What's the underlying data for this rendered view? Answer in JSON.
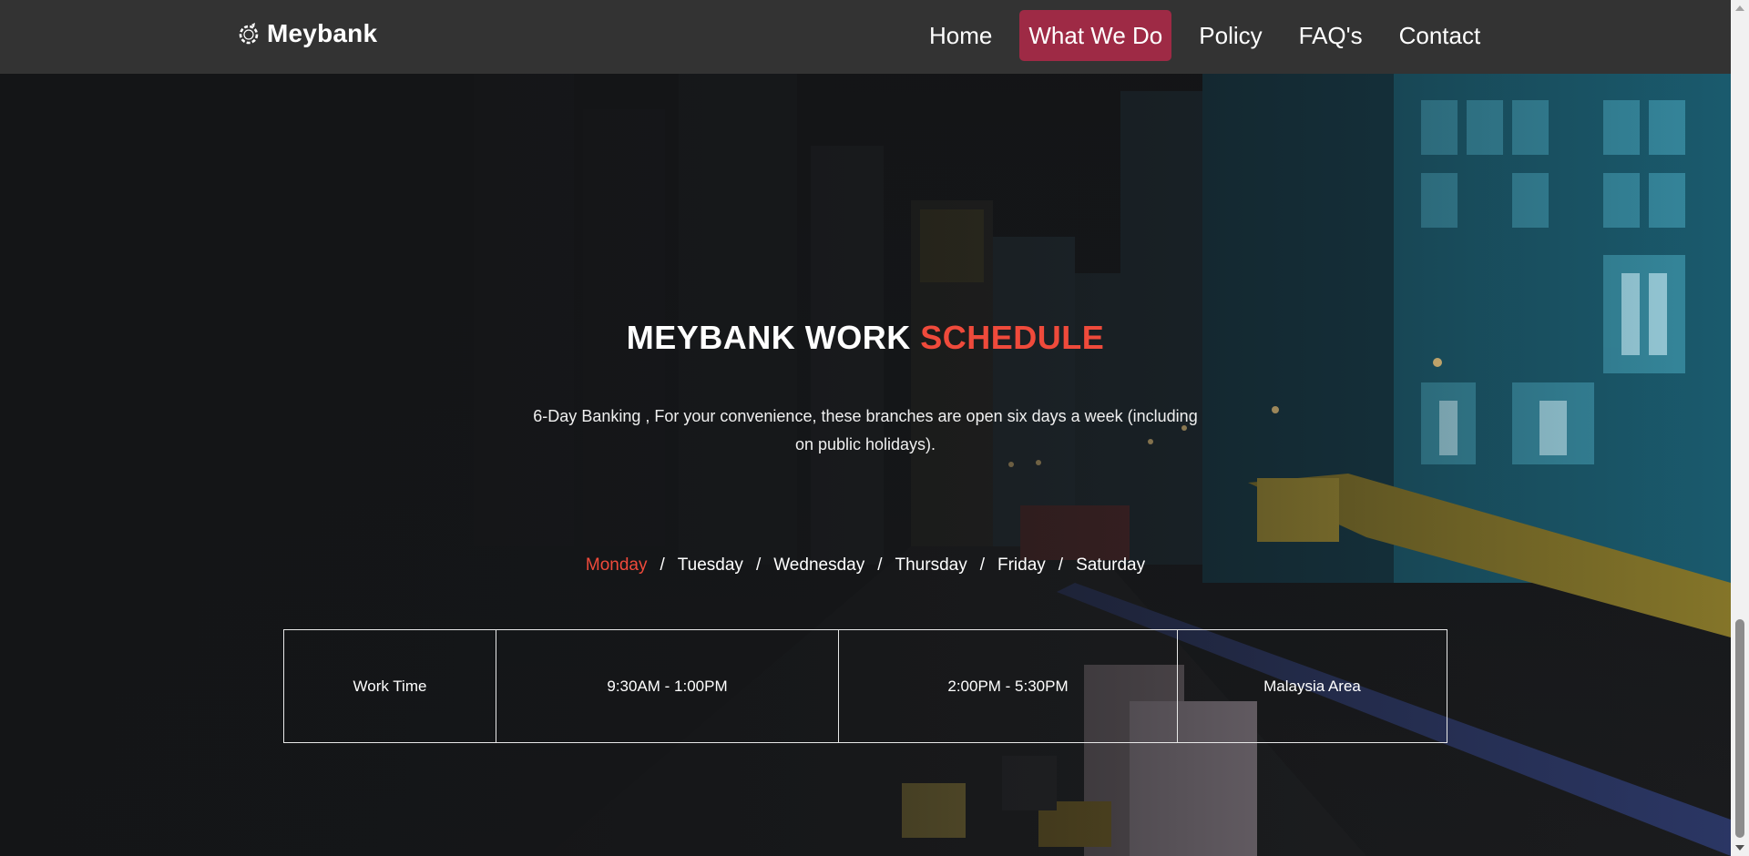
{
  "brand": {
    "name": "Meybank",
    "icon": "logo-ring-icon"
  },
  "nav": {
    "items": [
      "Home",
      "What We Do",
      "Policy",
      "FAQ's",
      "Contact"
    ],
    "active": "What We Do",
    "active_color": "#9e2a45"
  },
  "hero": {
    "title_main": "MEYBANK WORK ",
    "title_accent": "SCHEDULE",
    "accent_color": "#ef4a3b",
    "description": "6-Day Banking , For your convenience, these branches are open six days a week (including on public holidays)."
  },
  "days": {
    "items": [
      "Monday",
      "Tuesday",
      "Wednesday",
      "Thursday",
      "Friday",
      "Saturday"
    ],
    "separator": "/",
    "highlighted": "Monday"
  },
  "schedule": {
    "cells": [
      "Work Time",
      "9:30AM - 1:00PM",
      "2:00PM - 5:30PM",
      "Malaysia Area"
    ]
  }
}
